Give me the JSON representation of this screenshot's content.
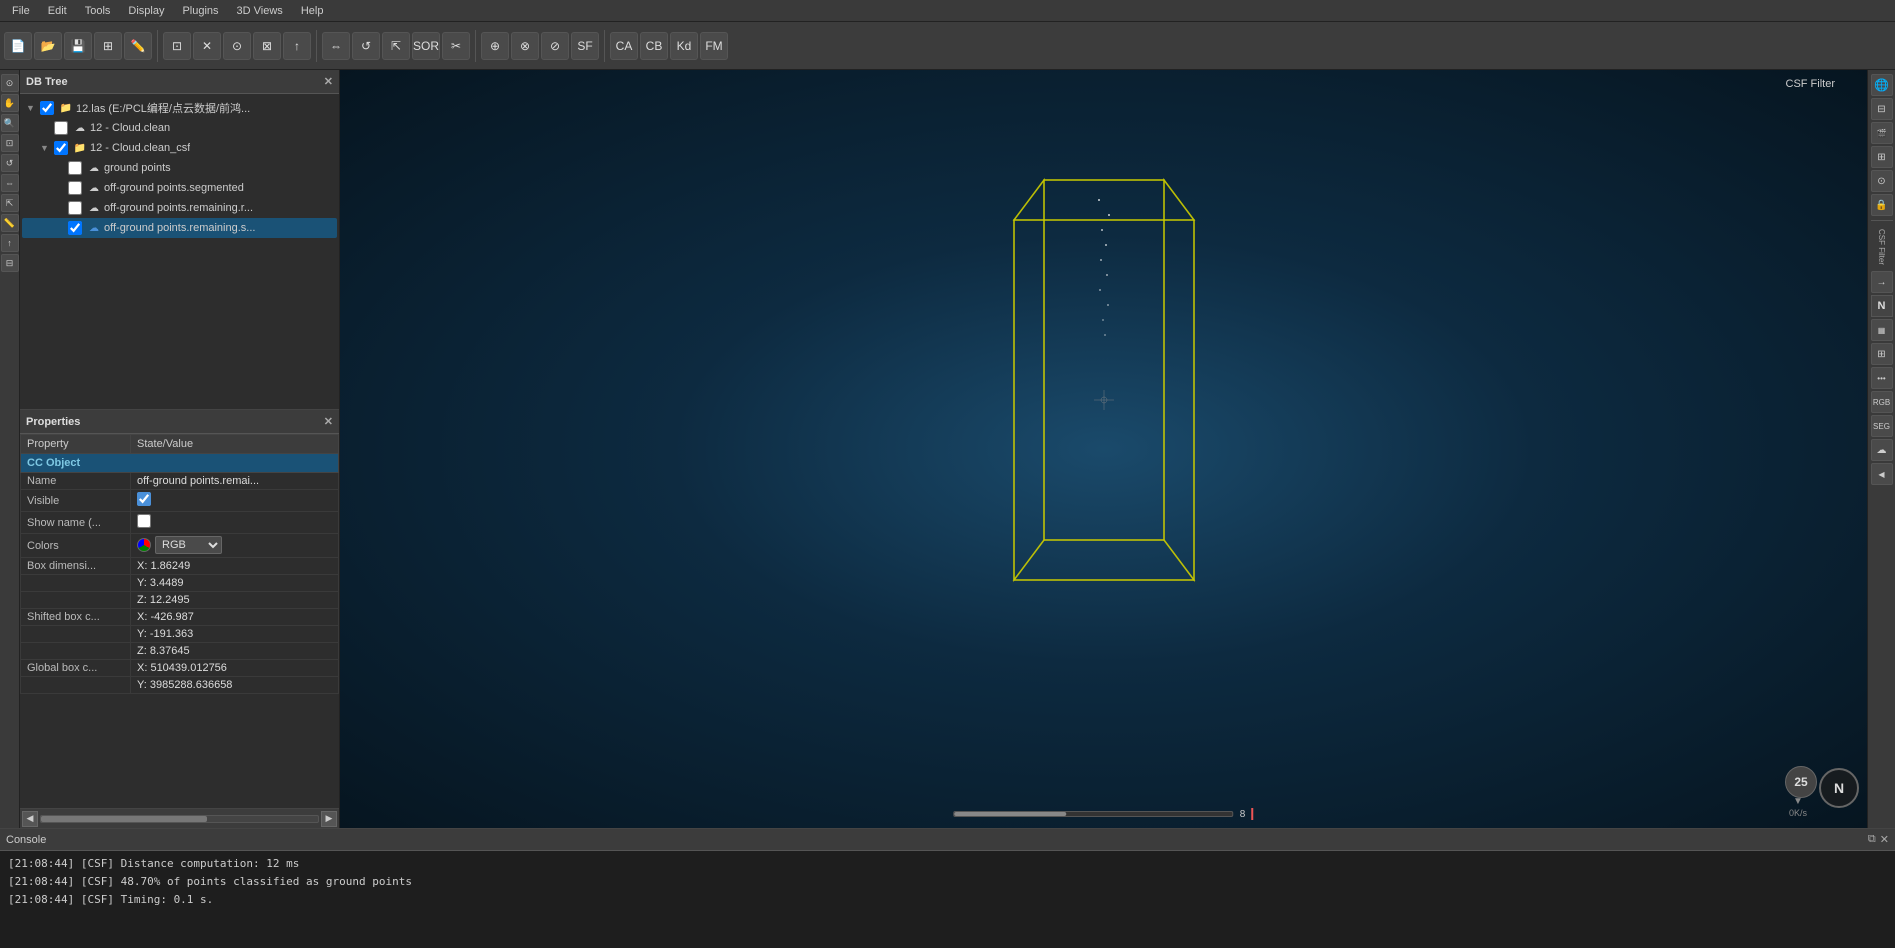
{
  "menubar": {
    "items": [
      "File",
      "Edit",
      "Tools",
      "Display",
      "Plugins",
      "3D Views",
      "Help"
    ]
  },
  "toolbar": {
    "buttons": [
      {
        "name": "new",
        "icon": "📄"
      },
      {
        "name": "open",
        "icon": "📂"
      },
      {
        "name": "save",
        "icon": "💾"
      },
      {
        "name": "properties",
        "icon": "⊞"
      },
      {
        "name": "edit",
        "icon": "✏️"
      },
      {
        "name": "select",
        "icon": "⊡"
      },
      {
        "name": "delete",
        "icon": "✕"
      },
      {
        "name": "filter",
        "icon": "⊙"
      },
      {
        "name": "sample",
        "icon": "⊠"
      },
      {
        "name": "pick",
        "icon": "↑"
      },
      {
        "name": "translate",
        "icon": "⇔"
      },
      {
        "name": "rotate",
        "icon": "↺"
      },
      {
        "name": "scale",
        "icon": "⇱"
      },
      {
        "name": "sor",
        "icon": "SOR"
      },
      {
        "name": "segment",
        "icon": "✂"
      },
      {
        "name": "extract",
        "icon": "⊕"
      },
      {
        "name": "merge",
        "icon": "⊗"
      },
      {
        "name": "split",
        "icon": "⊘"
      },
      {
        "name": "sf",
        "icon": "SF"
      },
      {
        "name": "canopy-create",
        "icon": "CA"
      },
      {
        "name": "canopy-classify",
        "icon": "CB"
      },
      {
        "name": "kd",
        "icon": "Kd"
      },
      {
        "name": "fm",
        "icon": "FM"
      }
    ]
  },
  "db_tree": {
    "title": "DB Tree",
    "items": [
      {
        "id": "root",
        "label": "12.las (E:/PCL编程/点云数据/前鸿...",
        "indent": 0,
        "checked": true,
        "arrow": "▼",
        "icon": "📁",
        "color": "#e8a000"
      },
      {
        "id": "cloud-clean",
        "label": "12 - Cloud.clean",
        "indent": 1,
        "checked": false,
        "arrow": "",
        "icon": "☁",
        "color": "#ccc"
      },
      {
        "id": "cloud-clean-csf",
        "label": "12 - Cloud.clean_csf",
        "indent": 1,
        "checked": true,
        "arrow": "▼",
        "icon": "📁",
        "color": "#7b7b7b"
      },
      {
        "id": "ground-points",
        "label": "ground points",
        "indent": 2,
        "checked": false,
        "arrow": "",
        "icon": "☁",
        "color": "#ccc"
      },
      {
        "id": "off-ground-segmented",
        "label": "off-ground points.segmented",
        "indent": 2,
        "checked": false,
        "arrow": "",
        "icon": "☁",
        "color": "#ccc"
      },
      {
        "id": "off-ground-remaining-r",
        "label": "off-ground points.remaining.r...",
        "indent": 2,
        "checked": false,
        "arrow": "",
        "icon": "☁",
        "color": "#ccc"
      },
      {
        "id": "off-ground-remaining-s",
        "label": "off-ground points.remaining.s...",
        "indent": 2,
        "checked": true,
        "arrow": "",
        "icon": "☁",
        "color": "#4a90d9",
        "selected": true
      }
    ]
  },
  "properties": {
    "title": "Properties",
    "columns": [
      "Property",
      "State/Value"
    ],
    "section": "CC Object",
    "rows": [
      {
        "property": "Name",
        "value": "off-ground points.remai..."
      },
      {
        "property": "Visible",
        "value": "checkbox_checked"
      },
      {
        "property": "Show name (...",
        "value": "checkbox_unchecked"
      },
      {
        "property": "Colors",
        "value": "RGB",
        "type": "color"
      },
      {
        "property": "Box dimensi...",
        "value": "",
        "subrows": [
          {
            "label": "X:",
            "value": "1.86249"
          },
          {
            "label": "Y:",
            "value": "3.4489"
          },
          {
            "label": "Z:",
            "value": "12.2495"
          }
        ]
      },
      {
        "property": "Shifted box c...",
        "value": "",
        "subrows": [
          {
            "label": "X:",
            "value": "-426.987"
          },
          {
            "label": "Y:",
            "value": "-191.363"
          },
          {
            "label": "Z:",
            "value": "8.37645"
          }
        ]
      },
      {
        "property": "Global box c...",
        "value": "",
        "subrows": [
          {
            "label": "X:",
            "value": "510439.012756"
          },
          {
            "label": "Y:",
            "value": "3985288.636658"
          }
        ]
      }
    ]
  },
  "console": {
    "title": "Console",
    "lines": [
      "[21:08:44] [CSF] Distance computation: 12 ms",
      "[21:08:44] [CSF] 48.70% of points classified as ground points",
      "[21:08:44] [CSF] Timing: 0.1 s."
    ]
  },
  "viewport": {
    "csf_filter_label": "CSF Filter",
    "compass_label": "N",
    "progress_value": 8,
    "speed_value": "0K/s"
  },
  "right_tools": {
    "items": [
      {
        "name": "globe",
        "icon": "🌐"
      },
      {
        "name": "layers",
        "icon": "⊟"
      },
      {
        "name": "camera",
        "icon": "🎬"
      },
      {
        "name": "transform",
        "icon": "⊞"
      },
      {
        "name": "compass2",
        "icon": "⊙"
      },
      {
        "name": "lock",
        "icon": "🔒"
      },
      {
        "name": "csf-filter",
        "label": "CSF Filter"
      },
      {
        "name": "north",
        "icon": "N"
      },
      {
        "name": "hist",
        "icon": "▦"
      },
      {
        "name": "grid",
        "icon": "⊞"
      },
      {
        "name": "pts",
        "icon": "•"
      },
      {
        "name": "rgb",
        "icon": "⊙"
      },
      {
        "name": "seg",
        "icon": "⊗"
      },
      {
        "name": "cloud",
        "icon": "☁"
      },
      {
        "name": "back",
        "icon": "◀"
      }
    ]
  }
}
